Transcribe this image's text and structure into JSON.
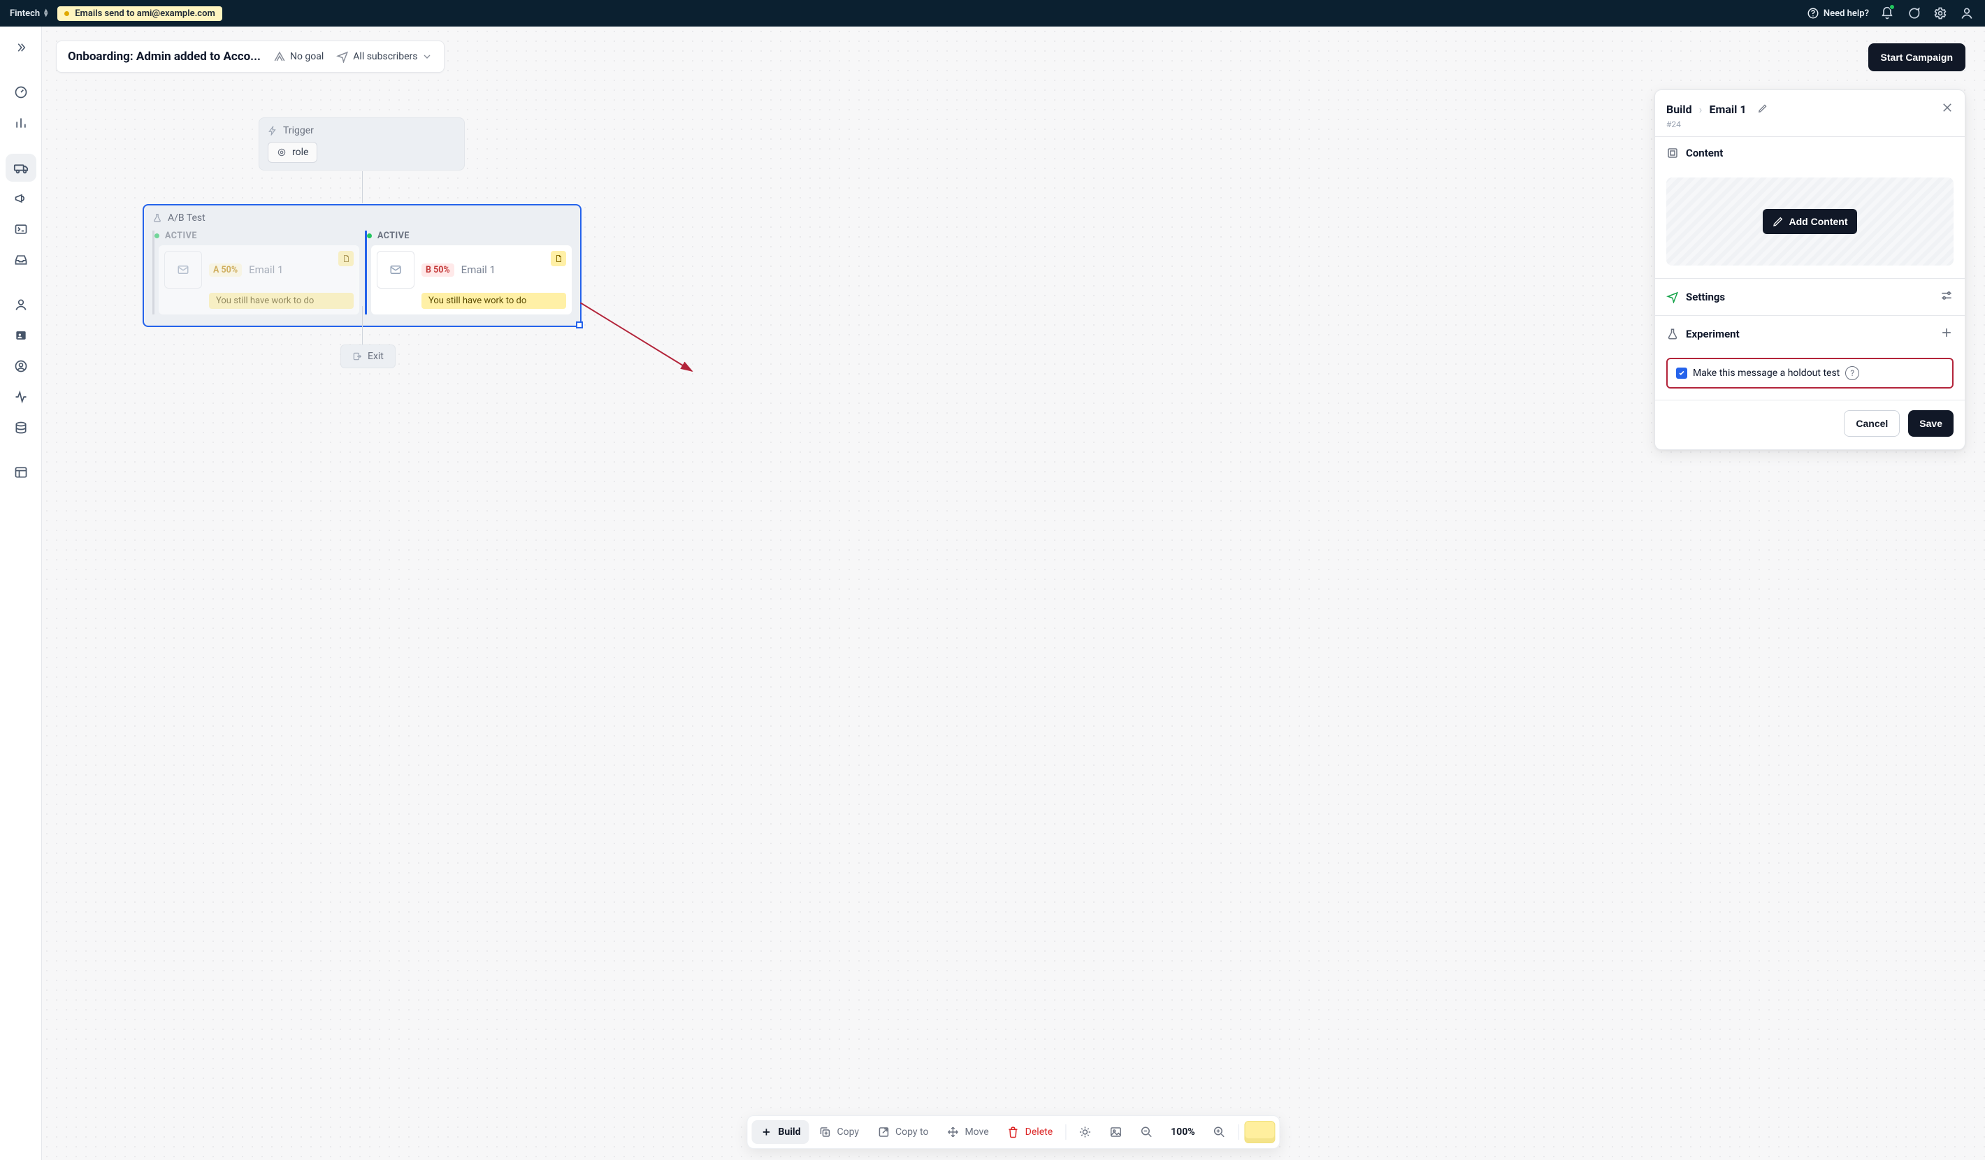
{
  "topbar": {
    "workspace": "Fintech",
    "chip": "Emails send to ami@example.com",
    "help": "Need help?"
  },
  "header": {
    "title": "Onboarding: Admin added to Acco...",
    "goal": "No goal",
    "audience": "All subscribers",
    "cta": "Start Campaign"
  },
  "nodes": {
    "trigger": {
      "label": "Trigger",
      "chip": "role"
    },
    "abtest": {
      "label": "A/B Test",
      "activeLabel": "ACTIVE",
      "a": {
        "variant": "A 50%",
        "title": "Email 1",
        "note": "You still have work to do"
      },
      "b": {
        "variant": "B 50%",
        "title": "Email 1",
        "note": "You still have work to do"
      }
    },
    "exit": "Exit"
  },
  "panel": {
    "breadcrumbRoot": "Build",
    "breadcrumbLeaf": "Email 1",
    "hashid": "#24",
    "sections": {
      "content": "Content",
      "addContent": "Add Content",
      "settings": "Settings",
      "experiment": "Experiment"
    },
    "holdout": "Make this message a holdout test",
    "cancel": "Cancel",
    "save": "Save"
  },
  "toolbar": {
    "build": "Build",
    "copy": "Copy",
    "copyTo": "Copy to",
    "move": "Move",
    "del": "Delete",
    "zoom": "100%"
  }
}
